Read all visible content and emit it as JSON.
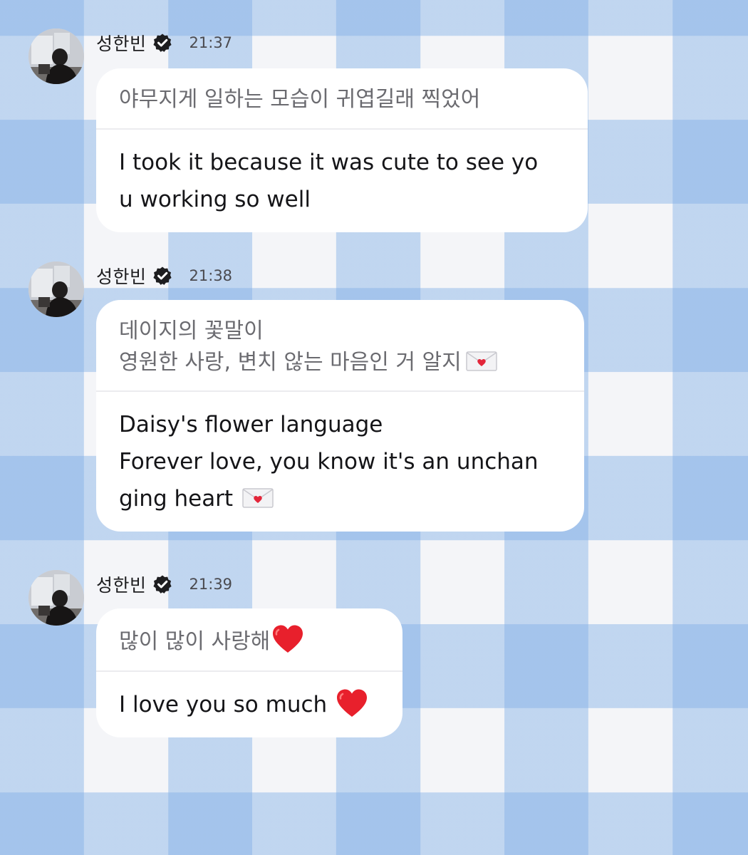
{
  "sender": {
    "name": "성한빈"
  },
  "messages": [
    {
      "time": "21:37",
      "original": "야무지게 일하는 모습이 귀엽길래 찍었어",
      "translation": "I took it because it was cute to see yo\nu working so well"
    },
    {
      "time": "21:38",
      "original": "데이지의 꽃말이\n영원한 사랑, 변치 않는 마음인 거 알지",
      "translation": "Daisy's flower language\nForever love, you know it's an unchan\nging heart",
      "original_emoji": "love-letter-icon",
      "translation_emoji": "love-letter-icon"
    },
    {
      "time": "21:39",
      "original": "많이 많이 사랑해",
      "translation": "I love you so much",
      "original_emoji": "red-heart-icon",
      "translation_emoji": "red-heart-icon"
    }
  ],
  "colors": {
    "background": "#f4f5f8",
    "check_blue": "#82afe6",
    "bubble": "#ffffff",
    "heart": "#e8202c",
    "verified_badge": "#1d1d1f"
  }
}
